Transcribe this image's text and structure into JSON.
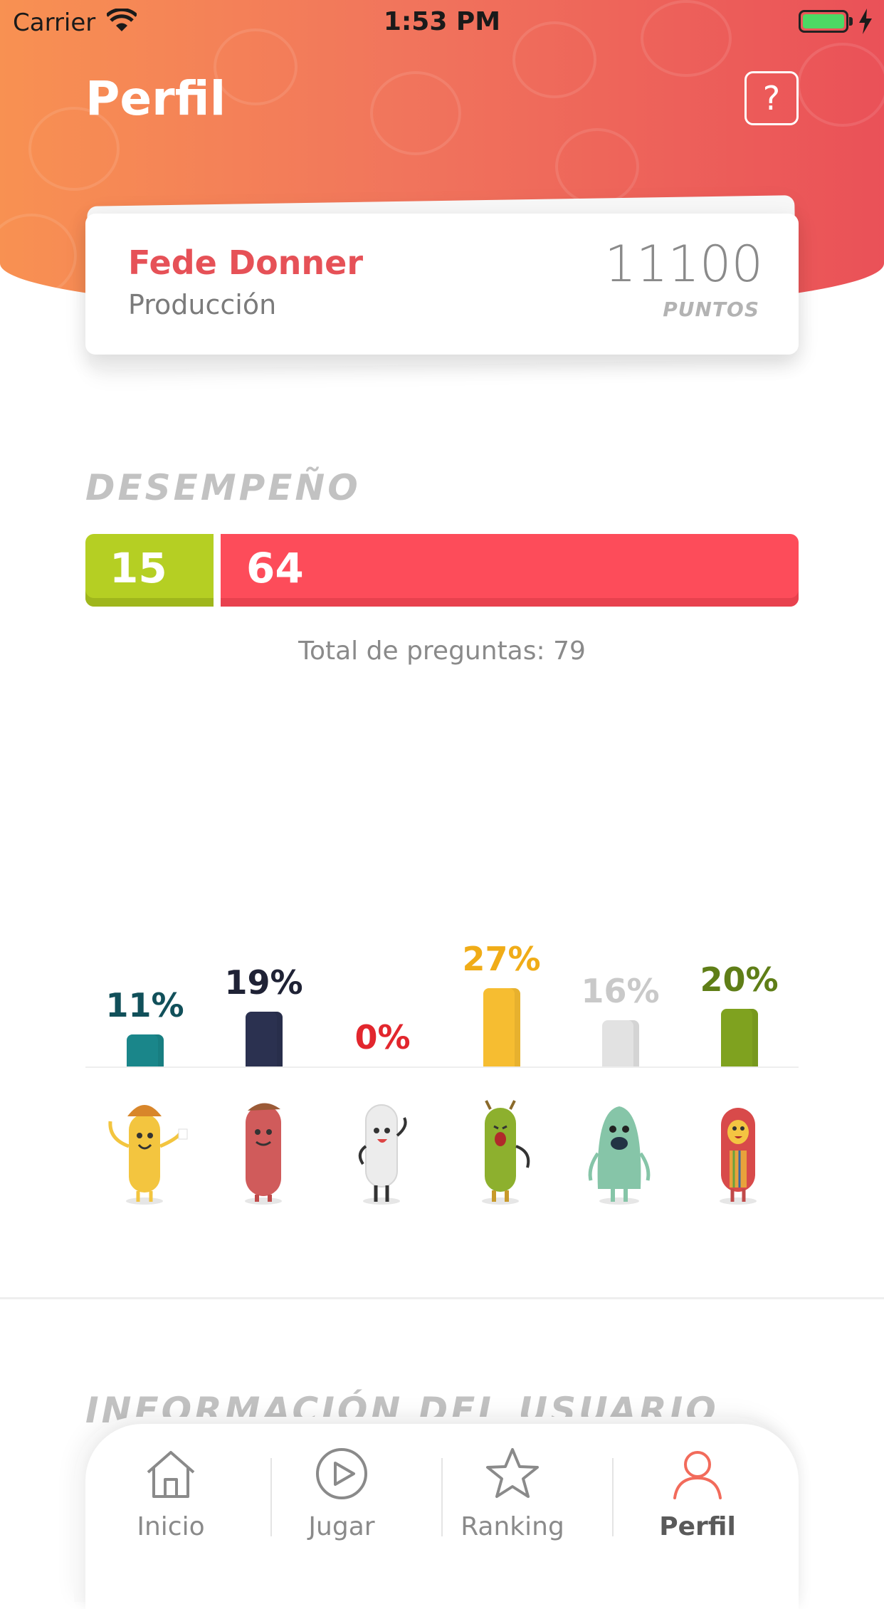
{
  "status_bar": {
    "carrier": "Carrier",
    "time": "1:53 PM"
  },
  "header": {
    "title": "Perfil",
    "help_label": "?"
  },
  "profile": {
    "name": "Fede Donner",
    "department": "Producción",
    "points": "11100",
    "points_label": "PUNTOS"
  },
  "performance": {
    "title": "DESEMPEÑO",
    "correct": "15",
    "wrong": "64",
    "total_text": "Total de preguntas: 79",
    "colors": {
      "correct": "#b5cf23",
      "wrong": "#fd4c5a"
    }
  },
  "chart_data": {
    "type": "bar",
    "categories": [
      "yellow-character",
      "red-character",
      "white-character",
      "green-character",
      "teal-character",
      "hooded-character"
    ],
    "values": [
      11,
      19,
      0,
      27,
      16,
      20
    ],
    "labels": [
      "11%",
      "19%",
      "0%",
      "27%",
      "16%",
      "20%"
    ],
    "colors": [
      "#1a868a",
      "#2b3150",
      "#e2262d",
      "#f6bd31",
      "#e2e2e2",
      "#7fa21f"
    ],
    "label_colors": [
      "#11505a",
      "#1f2235",
      "#e2262d",
      "#f0ac17",
      "#c9c9c9",
      "#5f7e17"
    ],
    "ylim": [
      0,
      27
    ]
  },
  "user_info": {
    "title": "INFORMACIÓN DEL USUARIO"
  },
  "tabbar": {
    "tabs": [
      {
        "label": "Inicio",
        "icon": "home-icon"
      },
      {
        "label": "Jugar",
        "icon": "play-icon"
      },
      {
        "label": "Ranking",
        "icon": "star-icon"
      },
      {
        "label": "Perfil",
        "icon": "user-icon"
      }
    ],
    "active": "Perfil",
    "active_color": "#f26b5b"
  }
}
